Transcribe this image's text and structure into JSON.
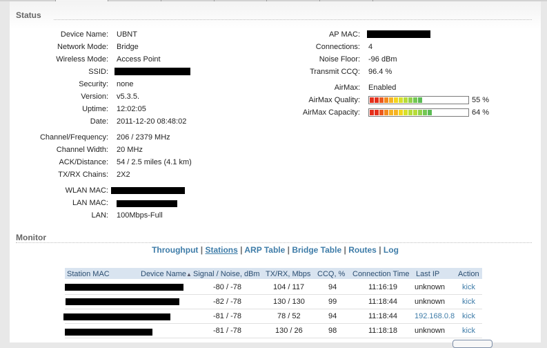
{
  "status": {
    "title": "Status",
    "left": [
      {
        "label": "Device Name:",
        "value": "UBNT"
      },
      {
        "label": "Network Mode:",
        "value": "Bridge"
      },
      {
        "label": "Wireless Mode:",
        "value": "Access Point"
      },
      {
        "label": "SSID:",
        "value": ""
      },
      {
        "label": "Security:",
        "value": "none"
      },
      {
        "label": "Version:",
        "value": "v5.3.5."
      },
      {
        "label": "Uptime:",
        "value": "12:02:05"
      },
      {
        "label": "Date:",
        "value": "2011-12-20 08:48:02"
      },
      {
        "label": "Channel/Frequency:",
        "value": "206 / 2379 MHz"
      },
      {
        "label": "Channel Width:",
        "value": "20 MHz"
      },
      {
        "label": "ACK/Distance:",
        "value": "54 / 2.5 miles (4.1 km)"
      },
      {
        "label": "TX/RX Chains:",
        "value": "2X2"
      },
      {
        "label": "WLAN MAC:",
        "value": ""
      },
      {
        "label": "LAN MAC:",
        "value": ""
      },
      {
        "label": "LAN:",
        "value": "100Mbps-Full"
      }
    ],
    "right": [
      {
        "label": "AP MAC:",
        "value": ""
      },
      {
        "label": "Connections:",
        "value": "4"
      },
      {
        "label": "Noise Floor:",
        "value": "-96 dBm"
      },
      {
        "label": "Transmit CCQ:",
        "value": "96.4 %"
      },
      {
        "label": "AirMax:",
        "value": "Enabled"
      }
    ],
    "airmax_quality": {
      "label": "AirMax Quality:",
      "percent": 55,
      "text": "55 %"
    },
    "airmax_capacity": {
      "label": "AirMax Capacity:",
      "percent": 64,
      "text": "64 %"
    },
    "bar_colors": [
      "#e5301c",
      "#ec5a1e",
      "#f28a1f",
      "#f6b322",
      "#f3d51f",
      "#d8e02a",
      "#b7dc3a",
      "#93d24a",
      "#74c754",
      "#5cbb55"
    ]
  },
  "monitor": {
    "title": "Monitor",
    "nav": [
      "Throughput",
      "Stations",
      "ARP Table",
      "Bridge Table",
      "Routes",
      "Log"
    ],
    "nav_active": "Stations",
    "nav_separator": "|",
    "columns": [
      "Station MAC",
      "Device Name",
      "Signal / Noise, dBm",
      "TX/RX, Mbps",
      "CCQ, %",
      "Connection Time",
      "Last IP",
      "Action"
    ],
    "rows": [
      {
        "mac": "",
        "device": "",
        "signal": "-80 / -78",
        "txrx": "104 / 117",
        "ccq": "94",
        "time": "11:16:19",
        "ip": "unknown",
        "action": "kick"
      },
      {
        "mac": "",
        "device": "",
        "signal": "-82 / -78",
        "txrx": "130 / 130",
        "ccq": "99",
        "time": "11:18:44",
        "ip": "unknown",
        "action": "kick"
      },
      {
        "mac": "",
        "device": "",
        "signal": "-81 / -78",
        "txrx": "78 / 52",
        "ccq": "94",
        "time": "11:18:44",
        "ip": "192.168.0.8",
        "action": "kick"
      },
      {
        "mac": "",
        "device": "",
        "signal": "-81 / -78",
        "txrx": "130 / 26",
        "ccq": "98",
        "time": "11:18:18",
        "ip": "unknown",
        "action": "kick"
      }
    ]
  }
}
